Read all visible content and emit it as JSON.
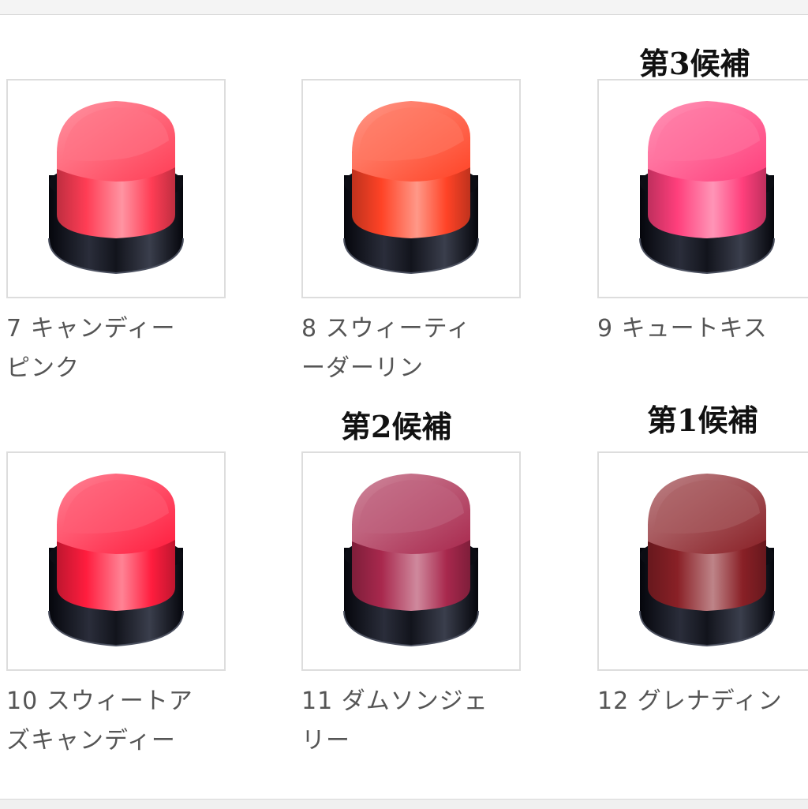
{
  "products": [
    {
      "num": "7",
      "name_line1": "キャンディー",
      "name_line2": "ピンク",
      "color": "#ff3d55",
      "rank": ""
    },
    {
      "num": "8",
      "name_line1": "スウィーティ",
      "name_line2": "ーダーリン",
      "color": "#ff4326",
      "rank": ""
    },
    {
      "num": "9",
      "name_line1": "キュートキス",
      "name_line2": "",
      "color": "#ff3f7c",
      "rank": "第3候補"
    },
    {
      "num": "10",
      "name_line1": "スウィートア",
      "name_line2": "ズキャンディー",
      "color": "#ff1d3e",
      "rank": ""
    },
    {
      "num": "11",
      "name_line1": "ダムソンジェ",
      "name_line2": "リー",
      "color": "#a8284d",
      "rank": "第2候補"
    },
    {
      "num": "12",
      "name_line1": "グレナディン",
      "name_line2": "",
      "color": "#892026",
      "rank": "第1候補"
    }
  ]
}
